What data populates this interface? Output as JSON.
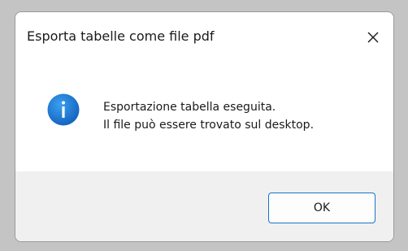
{
  "dialog": {
    "title": "Esporta tabelle come file pdf",
    "close_icon": "close-icon",
    "info_icon": "info-icon",
    "message_line1": "Esportazione tabella eseguita.",
    "message_line2": "Il file può essere trovato sul desktop.",
    "ok_label": "OK"
  },
  "colors": {
    "accent": "#1a73c8",
    "info_icon_blue": "#1e7fd6",
    "footer_bg": "#f0f0f0"
  }
}
